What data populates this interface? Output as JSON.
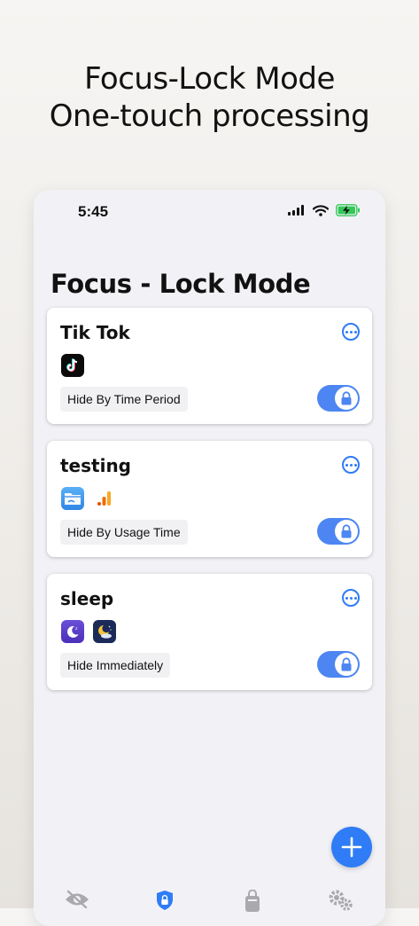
{
  "promo": {
    "line1": "Focus-Lock Mode",
    "line2": "One-touch processing"
  },
  "status_bar": {
    "time": "5:45",
    "icons": [
      "signal-icon",
      "wifi-icon",
      "battery-charging-icon"
    ]
  },
  "page": {
    "title": "Focus - Lock Mode"
  },
  "cards": [
    {
      "title": "Tik Tok",
      "apps": [
        "tiktok-app-icon"
      ],
      "rule": "Hide By Time Period",
      "locked": true
    },
    {
      "title": "testing",
      "apps": [
        "files-app-icon",
        "analytics-app-icon"
      ],
      "rule": "Hide By Usage Time",
      "locked": true
    },
    {
      "title": "sleep",
      "apps": [
        "sleep-app-icon",
        "moon-weather-app-icon"
      ],
      "rule": "Hide Immediately",
      "locked": true
    }
  ],
  "fab": {
    "icon": "plus-icon"
  },
  "tab_bar": {
    "icons": [
      "eye-slash-icon",
      "shield-lock-icon",
      "app-lock-icon",
      "gears-icon"
    ],
    "active_index": 1
  },
  "colors": {
    "accent": "#2f7cf6",
    "toggle_on": "#4d86f2",
    "battery": "#35c759"
  }
}
